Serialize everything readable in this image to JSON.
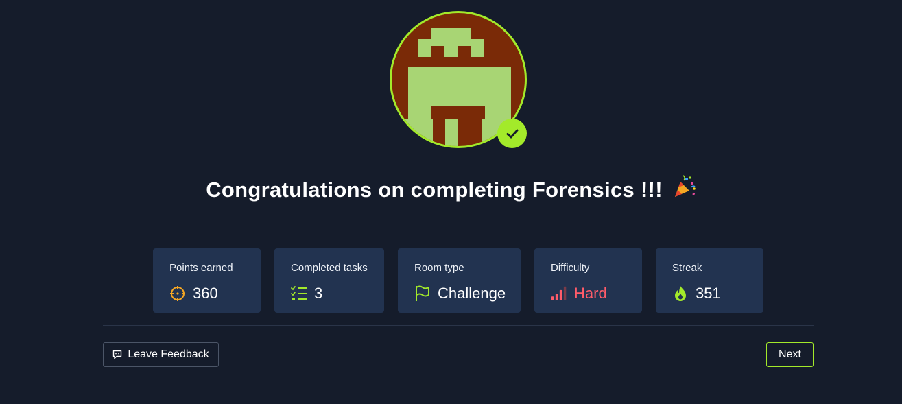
{
  "completion": {
    "heading": "Congratulations on completing Forensics !!!",
    "party_icon": "party-popper-icon",
    "avatar_icon": "pixel-room-logo",
    "check_icon": "check-icon"
  },
  "stats": [
    {
      "label": "Points earned",
      "value": "360",
      "icon": "crosshair-icon",
      "icon_color": "#f5a623"
    },
    {
      "label": "Completed tasks",
      "value": "3",
      "icon": "checklist-icon",
      "icon_color": "#a3ea2a"
    },
    {
      "label": "Room type",
      "value": "Challenge",
      "icon": "flag-icon",
      "icon_color": "#a3ea2a"
    },
    {
      "label": "Difficulty",
      "value": "Hard",
      "icon": "signal-bars-icon",
      "icon_color": "#ff5c6a"
    },
    {
      "label": "Streak",
      "value": "351",
      "icon": "flame-icon",
      "icon_color": "#a3ea2a"
    }
  ],
  "footer": {
    "feedback_label": "Leave Feedback",
    "feedback_icon": "message-icon",
    "next_label": "Next"
  },
  "colors": {
    "background": "#151c2b",
    "card": "#223350",
    "accent": "#a3ea2a",
    "avatar_bg": "#7a2a07",
    "avatar_fg": "#a8d574",
    "hard": "#ff5c6a",
    "points": "#f5a623"
  }
}
